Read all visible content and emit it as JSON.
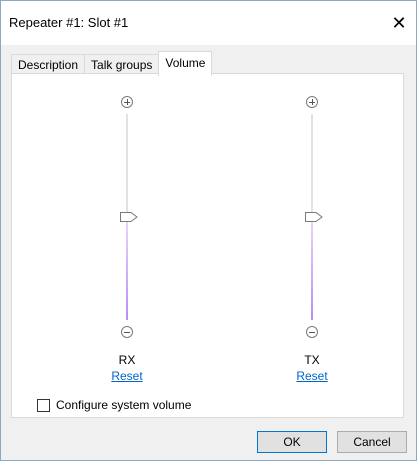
{
  "window": {
    "title": "Repeater #1: Slot #1",
    "close_glyph": "✕"
  },
  "tabs": [
    {
      "label": "Description",
      "active": false
    },
    {
      "label": "Talk groups",
      "active": false
    },
    {
      "label": "Volume",
      "active": true
    }
  ],
  "sliders": [
    {
      "name": "RX",
      "reset_label": "Reset",
      "level": 0.5
    },
    {
      "name": "TX",
      "reset_label": "Reset",
      "level": 0.5
    }
  ],
  "checkbox": {
    "label": "Configure system volume",
    "checked": false
  },
  "buttons": {
    "ok_label": "OK",
    "cancel_label": "Cancel"
  },
  "colors": {
    "accent": "#0078d7",
    "link": "#0066cc",
    "slider_fill": "#b98ef0"
  }
}
